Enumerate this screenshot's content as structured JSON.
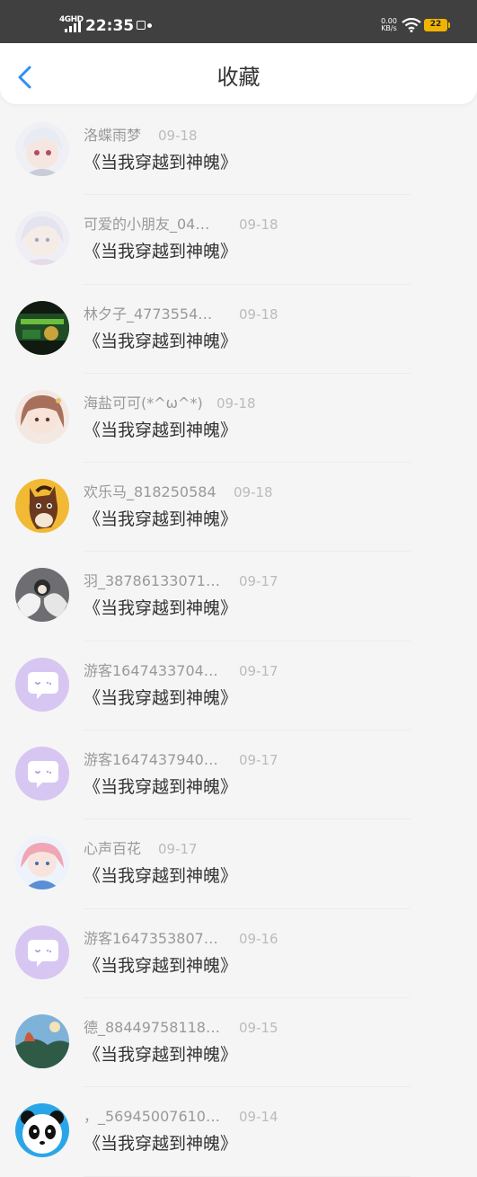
{
  "status_bar": {
    "network": "4GHD",
    "time": "22:35",
    "speed_value": "0.00",
    "speed_unit": "KB/s",
    "battery": "22"
  },
  "header": {
    "title": "收藏",
    "back_icon": "chevron-left-icon"
  },
  "items": [
    {
      "name": "洛蝶雨梦",
      "date": "09-18",
      "work": "《当我穿越到神魄》",
      "avatar": "anime-girl-white-hair"
    },
    {
      "name": "可爱的小朋友_04…",
      "date": "09-18",
      "work": "《当我穿越到神魄》",
      "avatar": "anime-girl-pastel"
    },
    {
      "name": "林夕子_4773554…",
      "date": "09-18",
      "work": "《当我穿越到神魄》",
      "avatar": "dark-green-poster"
    },
    {
      "name": "海盐可可(*^ω^*)",
      "date": "09-18",
      "work": "《当我穿越到神魄》",
      "avatar": "anime-girl-brown-hair"
    },
    {
      "name": "欢乐马_818250584",
      "date": "09-18",
      "work": "《当我穿越到神魄》",
      "avatar": "cartoon-horse"
    },
    {
      "name": "羽_38786133071…",
      "date": "09-17",
      "work": "《当我穿越到神魄》",
      "avatar": "angel-wings"
    },
    {
      "name": "游客1647433704…",
      "date": "09-17",
      "work": "《当我穿越到神魄》",
      "avatar": "default-chat-bubble"
    },
    {
      "name": "游客1647437940…",
      "date": "09-17",
      "work": "《当我穿越到神魄》",
      "avatar": "default-chat-bubble"
    },
    {
      "name": "心声百花",
      "date": "09-17",
      "work": "《当我穿越到神魄》",
      "avatar": "anime-girl-blue"
    },
    {
      "name": "游客1647353807…",
      "date": "09-16",
      "work": "《当我穿越到神魄》",
      "avatar": "default-chat-bubble"
    },
    {
      "name": "德_88449758118…",
      "date": "09-15",
      "work": "《当我穿越到神魄》",
      "avatar": "landscape-scene"
    },
    {
      "name": "，_56945007610…",
      "date": "09-14",
      "work": "《当我穿越到神魄》",
      "avatar": "panda"
    }
  ],
  "colors": {
    "accent": "#2f8ff0",
    "default_avatar": "#d7c6f2",
    "battery": "#f0b400"
  }
}
